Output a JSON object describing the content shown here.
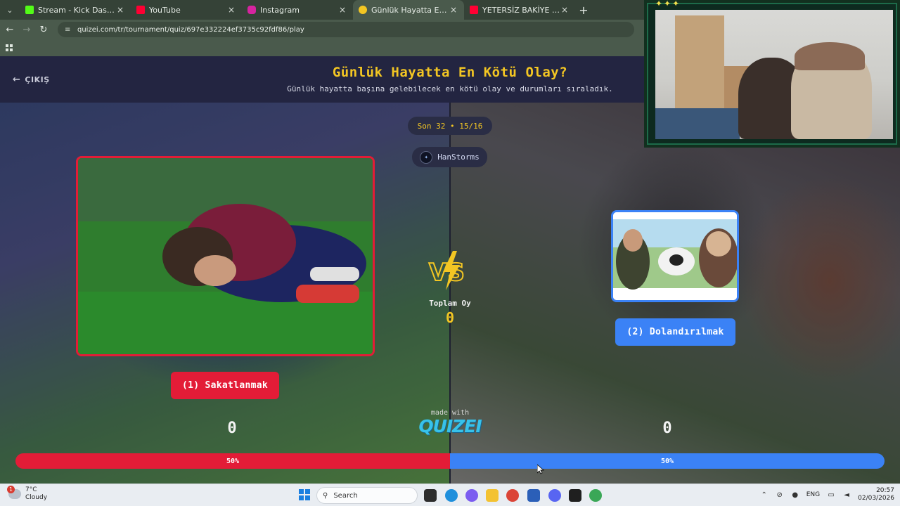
{
  "browser": {
    "tabs": [
      {
        "label": "Stream - Kick Dashboard",
        "favicon": "kick-icon",
        "color": "#53fc18",
        "active": false
      },
      {
        "label": "YouTube",
        "favicon": "youtube-icon",
        "color": "#ff0033",
        "active": false
      },
      {
        "label": "Instagram",
        "favicon": "instagram-icon",
        "color": "#d6249f",
        "active": false
      },
      {
        "label": "Günlük Hayatta En Kötü Olay?",
        "favicon": "quizei-icon",
        "color": "#f3c623",
        "active": true
      },
      {
        "label": "YETERSİZ BAKİYE - YouTube",
        "favicon": "youtube-icon",
        "color": "#ff0033",
        "active": false
      }
    ],
    "url": "quizei.com/tr/tournament/quiz/697e332224ef3735c92fdf86/play"
  },
  "header": {
    "exit_label": "ÇIKIŞ",
    "title": "Günlük Hayatta En Kötü Olay?",
    "subtitle": "Günlük hayatta başına gelebilecek en kötü olay ve durumları sıraladık."
  },
  "round": {
    "label": "Son 32 • 15/16"
  },
  "creator": {
    "name": "HanStorms"
  },
  "options": [
    {
      "label": "(1) Sakatlanmak",
      "votes": "0",
      "percent": "50%",
      "color": "#e31c37"
    },
    {
      "label": "(2) Dolandırılmak",
      "votes": "0",
      "percent": "50%",
      "color": "#3b82f6"
    }
  ],
  "center": {
    "vs_text": "VS",
    "total_label": "Toplam Oy",
    "total_value": "0",
    "made_with": "made with",
    "brand": "QUIZEI"
  },
  "colors": {
    "accent": "#f3c623",
    "red": "#e31c37",
    "blue": "#3b82f6"
  },
  "taskbar": {
    "weather_temp": "7°C",
    "weather_desc": "Cloudy",
    "weather_badge": "1",
    "search_label": "Search",
    "lang": "ENG",
    "time": "20:57",
    "date": "02/03/2026"
  }
}
